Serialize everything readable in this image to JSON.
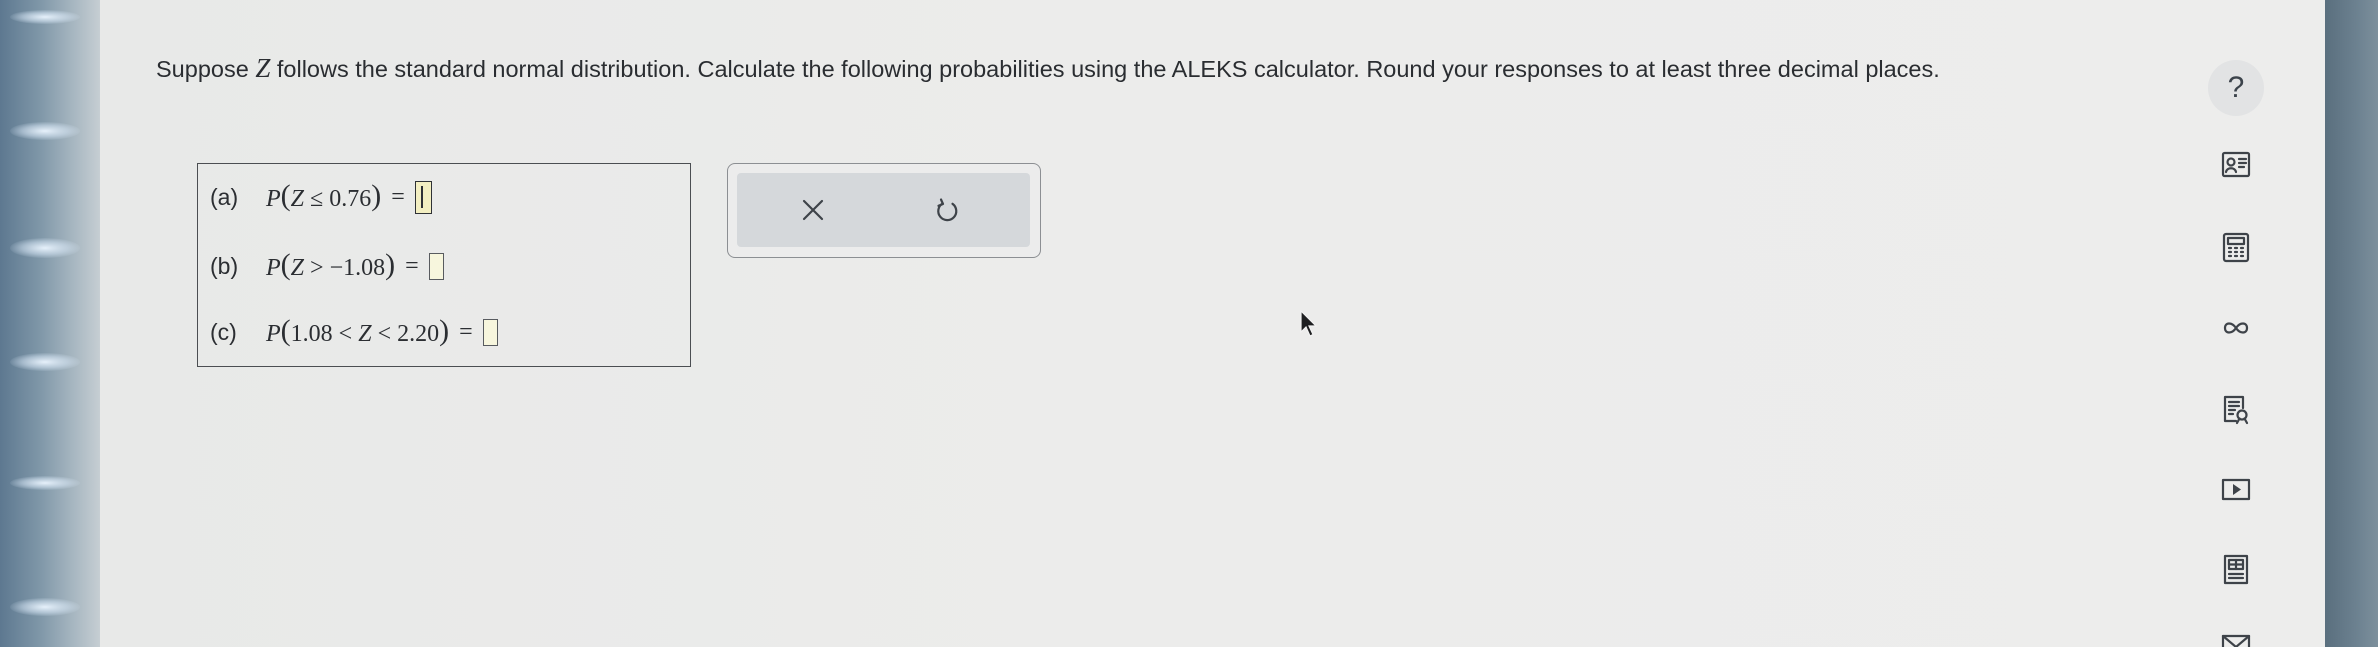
{
  "question": {
    "before_var": "Suppose ",
    "variable": "Z",
    "after_var": " follows the standard normal distribution. Calculate the following probabilities using the ALEKS calculator. Round your responses to at least three decimal places."
  },
  "parts": [
    {
      "label": "(a)",
      "func": "P",
      "inside_before": "",
      "var": "Z",
      "inside_after": " ≤ 0.76",
      "equals": "=",
      "answer_value": ""
    },
    {
      "label": "(b)",
      "func": "P",
      "inside_before": "",
      "var": "Z",
      "inside_after": " > −1.08",
      "equals": "=",
      "answer_value": ""
    },
    {
      "label": "(c)",
      "func": "P",
      "inside_before": "1.08 < ",
      "var": "Z",
      "inside_after": " < 2.20",
      "equals": "=",
      "answer_value": ""
    }
  ],
  "actions": {
    "clear_icon": "x-icon",
    "undo_icon": "undo-icon"
  },
  "sidebar": {
    "help_label": "?",
    "tools": [
      "help-icon",
      "gradebook-icon",
      "calculator-icon",
      "infinity-icon",
      "textbook-icon",
      "video-icon",
      "data-table-icon",
      "mail-icon"
    ]
  },
  "colors": {
    "page_bg": "#ececeb",
    "text": "#2a2d31",
    "answer_box_fill": "#f7f6dd",
    "action_panel_bg": "#d5d8db"
  }
}
